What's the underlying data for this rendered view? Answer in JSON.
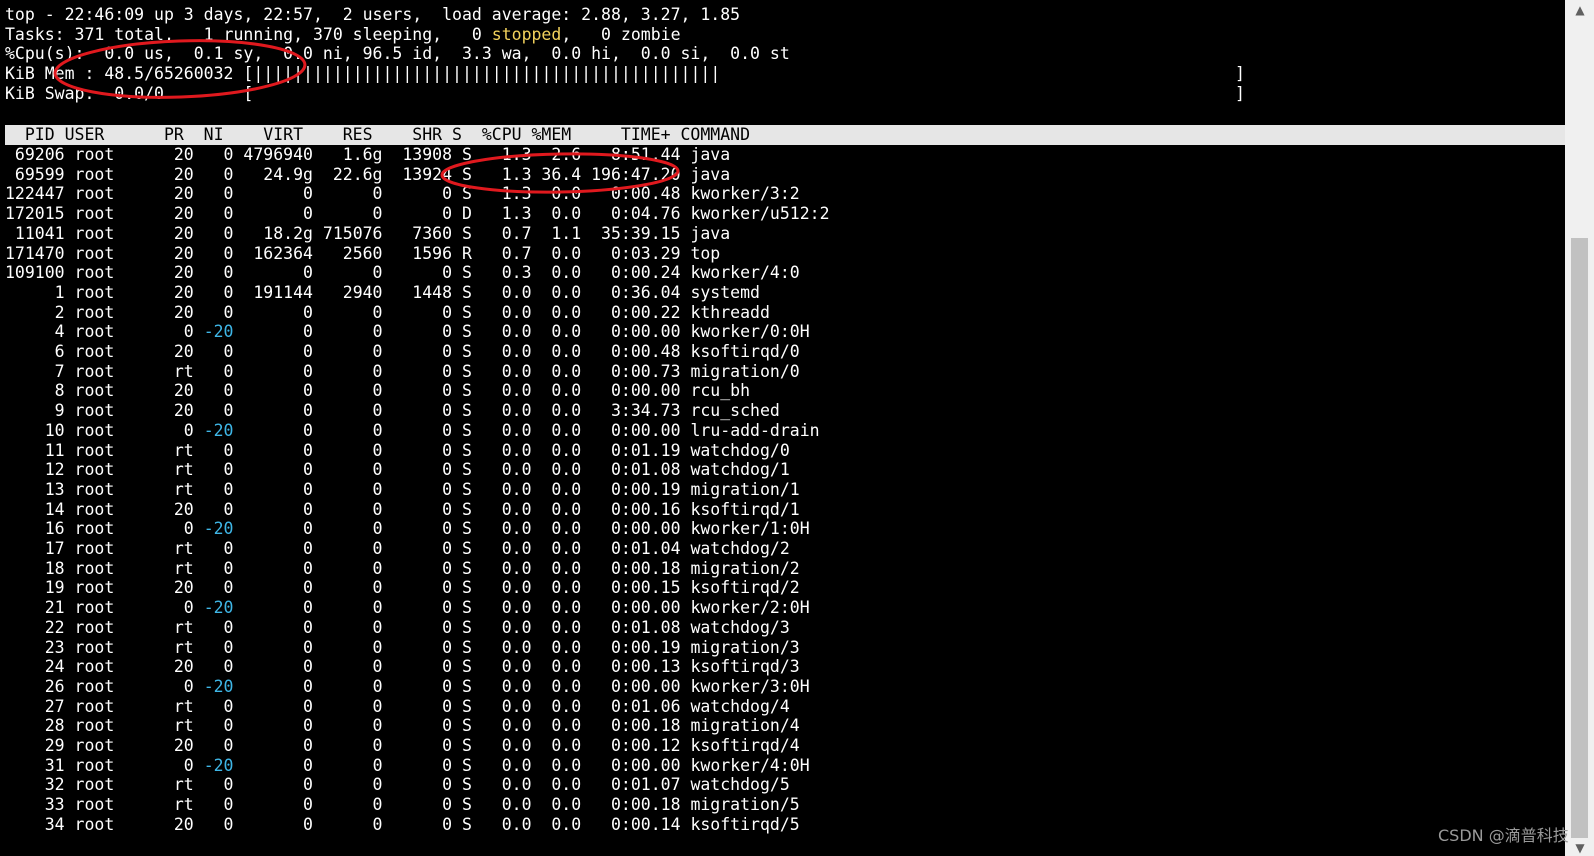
{
  "summary": {
    "line1": "top - 22:46:09 up 3 days, 22:57,  2 users,  load average: 2.88, 3.27, 1.85",
    "tasks_pre": "Tasks: 371 total,   1 running, 370 sleeping,   0 ",
    "tasks_stopped": "stopped",
    "tasks_post": ",   0 zombie",
    "cpu": "%Cpu(s):  0.0 us,  0.1 sy,  0.0 ni, 96.5 id,  3.3 wa,  0.0 hi,  0.0 si,  0.0 st",
    "mem_label": "KiB Mem : 48.5/65260032 [",
    "mem_bar": "|||||||||||||||||||||||||||||||||||||||||||||||",
    "mem_end": "]",
    "swap_label": "KiB Swap:  0.0/0        [",
    "swap_end": "]"
  },
  "header": "  PID USER      PR  NI    VIRT    RES    SHR S  %CPU %MEM     TIME+ COMMAND",
  "rows": [
    {
      "pre": " 69206 root      20   0 ",
      "ni": "",
      "post": "4796940   1.6g  13908 S   1.3  2.6   8:51.44 java"
    },
    {
      "pre": " 69599 root      20   0 ",
      "ni": "",
      "post": "  24.9g  22.6g  13924 S   1.3 36.4 196:47.20 java"
    },
    {
      "pre": "122447 root      20   0 ",
      "ni": "",
      "post": "      0      0      0 S   1.3  0.0   0:00.48 kworker/3:2"
    },
    {
      "pre": "172015 root      20   0 ",
      "ni": "",
      "post": "      0      0      0 D   1.3  0.0   0:04.76 kworker/u512:2"
    },
    {
      "pre": " 11041 root      20   0 ",
      "ni": "",
      "post": "  18.2g 715076   7360 S   0.7  1.1  35:39.15 java"
    },
    {
      "pre": "171470 root      20   0 ",
      "ni": "",
      "post": " 162364   2560   1596 R   0.7  0.0   0:03.29 top"
    },
    {
      "pre": "109100 root      20   0 ",
      "ni": "",
      "post": "      0      0      0 S   0.3  0.0   0:00.24 kworker/4:0"
    },
    {
      "pre": "     1 root      20   0 ",
      "ni": "",
      "post": " 191144   2940   1448 S   0.0  0.0   0:36.04 systemd"
    },
    {
      "pre": "     2 root      20   0 ",
      "ni": "",
      "post": "      0      0      0 S   0.0  0.0   0:00.22 kthreadd"
    },
    {
      "pre": "     4 root       0 ",
      "ni": "-20",
      "post": "       0      0      0 S   0.0  0.0   0:00.00 kworker/0:0H"
    },
    {
      "pre": "     6 root      20   0 ",
      "ni": "",
      "post": "      0      0      0 S   0.0  0.0   0:00.48 ksoftirqd/0"
    },
    {
      "pre": "     7 root      rt   0 ",
      "ni": "",
      "post": "      0      0      0 S   0.0  0.0   0:00.73 migration/0"
    },
    {
      "pre": "     8 root      20   0 ",
      "ni": "",
      "post": "      0      0      0 S   0.0  0.0   0:00.00 rcu_bh"
    },
    {
      "pre": "     9 root      20   0 ",
      "ni": "",
      "post": "      0      0      0 S   0.0  0.0   3:34.73 rcu_sched"
    },
    {
      "pre": "    10 root       0 ",
      "ni": "-20",
      "post": "       0      0      0 S   0.0  0.0   0:00.00 lru-add-drain"
    },
    {
      "pre": "    11 root      rt   0 ",
      "ni": "",
      "post": "      0      0      0 S   0.0  0.0   0:01.19 watchdog/0"
    },
    {
      "pre": "    12 root      rt   0 ",
      "ni": "",
      "post": "      0      0      0 S   0.0  0.0   0:01.08 watchdog/1"
    },
    {
      "pre": "    13 root      rt   0 ",
      "ni": "",
      "post": "      0      0      0 S   0.0  0.0   0:00.19 migration/1"
    },
    {
      "pre": "    14 root      20   0 ",
      "ni": "",
      "post": "      0      0      0 S   0.0  0.0   0:00.16 ksoftirqd/1"
    },
    {
      "pre": "    16 root       0 ",
      "ni": "-20",
      "post": "       0      0      0 S   0.0  0.0   0:00.00 kworker/1:0H"
    },
    {
      "pre": "    17 root      rt   0 ",
      "ni": "",
      "post": "      0      0      0 S   0.0  0.0   0:01.04 watchdog/2"
    },
    {
      "pre": "    18 root      rt   0 ",
      "ni": "",
      "post": "      0      0      0 S   0.0  0.0   0:00.18 migration/2"
    },
    {
      "pre": "    19 root      20   0 ",
      "ni": "",
      "post": "      0      0      0 S   0.0  0.0   0:00.15 ksoftirqd/2"
    },
    {
      "pre": "    21 root       0 ",
      "ni": "-20",
      "post": "       0      0      0 S   0.0  0.0   0:00.00 kworker/2:0H"
    },
    {
      "pre": "    22 root      rt   0 ",
      "ni": "",
      "post": "      0      0      0 S   0.0  0.0   0:01.08 watchdog/3"
    },
    {
      "pre": "    23 root      rt   0 ",
      "ni": "",
      "post": "      0      0      0 S   0.0  0.0   0:00.19 migration/3"
    },
    {
      "pre": "    24 root      20   0 ",
      "ni": "",
      "post": "      0      0      0 S   0.0  0.0   0:00.13 ksoftirqd/3"
    },
    {
      "pre": "    26 root       0 ",
      "ni": "-20",
      "post": "       0      0      0 S   0.0  0.0   0:00.00 kworker/3:0H"
    },
    {
      "pre": "    27 root      rt   0 ",
      "ni": "",
      "post": "      0      0      0 S   0.0  0.0   0:01.06 watchdog/4"
    },
    {
      "pre": "    28 root      rt   0 ",
      "ni": "",
      "post": "      0      0      0 S   0.0  0.0   0:00.18 migration/4"
    },
    {
      "pre": "    29 root      20   0 ",
      "ni": "",
      "post": "      0      0      0 S   0.0  0.0   0:00.12 ksoftirqd/4"
    },
    {
      "pre": "    31 root       0 ",
      "ni": "-20",
      "post": "       0      0      0 S   0.0  0.0   0:00.00 kworker/4:0H"
    },
    {
      "pre": "    32 root      rt   0 ",
      "ni": "",
      "post": "      0      0      0 S   0.0  0.0   0:01.07 watchdog/5"
    },
    {
      "pre": "    33 root      rt   0 ",
      "ni": "",
      "post": "      0      0      0 S   0.0  0.0   0:00.18 migration/5"
    },
    {
      "pre": "    34 root      20   0 ",
      "ni": "",
      "post": "      0      0      0 S   0.0  0.0   0:00.14 ksoftirqd/5"
    }
  ],
  "watermark": "CSDN @滴普科技",
  "colors": {
    "background": "#000000",
    "text": "#ffffff",
    "stopped": "#f2d25c",
    "negative_nice": "#3fb6e6",
    "annotation": "#e0191e"
  }
}
